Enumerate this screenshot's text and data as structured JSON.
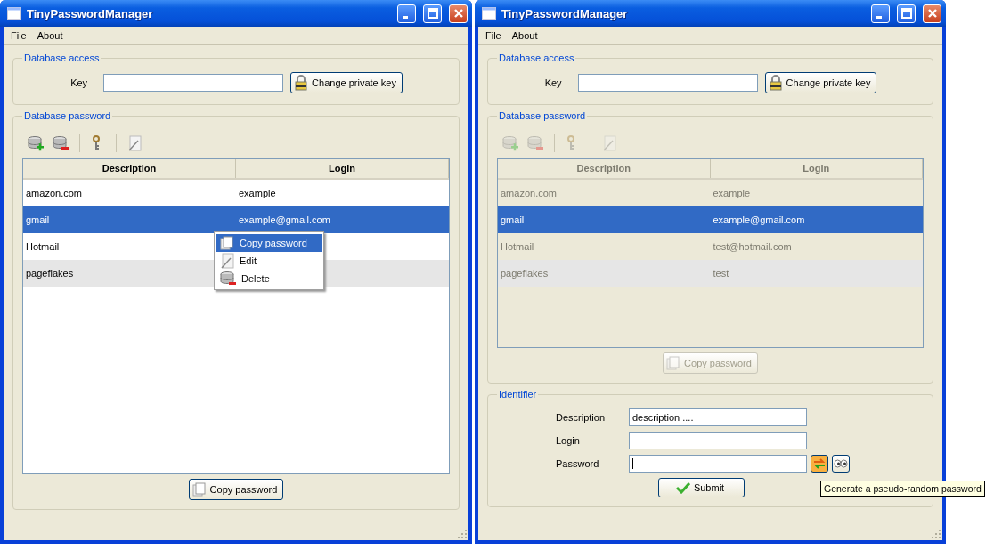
{
  "windows": [
    {
      "title": "TinyPasswordManager",
      "menu": [
        "File",
        "About"
      ],
      "access": {
        "legend": "Database access",
        "label": "Key",
        "button": "Change private key"
      },
      "passwords": {
        "legend": "Database password",
        "disabled": false,
        "toolbar": [
          {
            "kind": "add",
            "disabled": false
          },
          {
            "kind": "remove",
            "disabled": false
          },
          {
            "kind": "key",
            "disabled": false
          },
          {
            "kind": "edit",
            "disabled": false
          }
        ],
        "columns": [
          "Description",
          "Login"
        ],
        "rows": [
          {
            "description": "amazon.com",
            "login": "example",
            "selected": false
          },
          {
            "description": "gmail",
            "login": "example@gmail.com",
            "selected": true
          },
          {
            "description": "Hotmail",
            "selected": false
          },
          {
            "description": "pageflakes",
            "selected": false
          }
        ],
        "copy_button": {
          "label": "Copy password",
          "disabled": false
        }
      },
      "context_menu": {
        "items": [
          {
            "kind": "copy",
            "label": "Copy password",
            "selected": true
          },
          {
            "kind": "edit",
            "label": "Edit",
            "selected": false
          },
          {
            "kind": "delete",
            "label": "Delete",
            "selected": false
          }
        ]
      }
    },
    {
      "title": "TinyPasswordManager",
      "menu": [
        "File",
        "About"
      ],
      "access": {
        "legend": "Database access",
        "label": "Key",
        "button": "Change private key"
      },
      "passwords": {
        "legend": "Database password",
        "disabled": true,
        "toolbar": [
          {
            "kind": "add",
            "disabled": true
          },
          {
            "kind": "remove",
            "disabled": true
          },
          {
            "kind": "key",
            "disabled": true
          },
          {
            "kind": "edit",
            "disabled": true
          }
        ],
        "columns": [
          "Description",
          "Login"
        ],
        "rows": [
          {
            "description": "amazon.com",
            "login": "example",
            "selected": false
          },
          {
            "description": "gmail",
            "login": "example@gmail.com",
            "selected": true
          },
          {
            "description": "Hotmail",
            "login": "test@hotmail.com",
            "selected": false
          },
          {
            "description": "pageflakes",
            "login": "test",
            "selected": false
          }
        ],
        "copy_button": {
          "label": "Copy password",
          "disabled": true
        }
      },
      "identifier": {
        "legend": "Identifier",
        "fields": [
          {
            "label": "Description",
            "value": "description ...."
          },
          {
            "label": "Login"
          },
          {
            "label": "Password",
            "focused": true
          }
        ],
        "submit": "Submit",
        "tooltip": "Generate a pseudo-random password"
      }
    }
  ]
}
